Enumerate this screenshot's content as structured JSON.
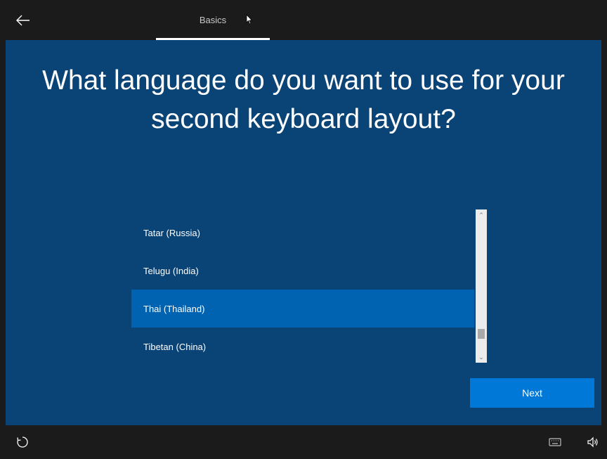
{
  "header": {
    "back_icon": "arrow-left-icon",
    "tab_label": "Basics"
  },
  "main": {
    "title": "What language do you want to use for your second keyboard layout?",
    "languages": [
      {
        "label": "Tatar (Russia)",
        "selected": false
      },
      {
        "label": "Telugu (India)",
        "selected": false
      },
      {
        "label": "Thai (Thailand)",
        "selected": true
      },
      {
        "label": "Tibetan (China)",
        "selected": false
      }
    ],
    "next_label": "Next"
  },
  "footer": {
    "ease_of_access_icon": "ease-of-access-icon",
    "keyboard_icon": "keyboard-icon",
    "volume_icon": "volume-icon"
  },
  "colors": {
    "background": "#0a4375",
    "selected": "#0063b1",
    "button": "#0078d7",
    "chrome": "#1b1b1b"
  }
}
